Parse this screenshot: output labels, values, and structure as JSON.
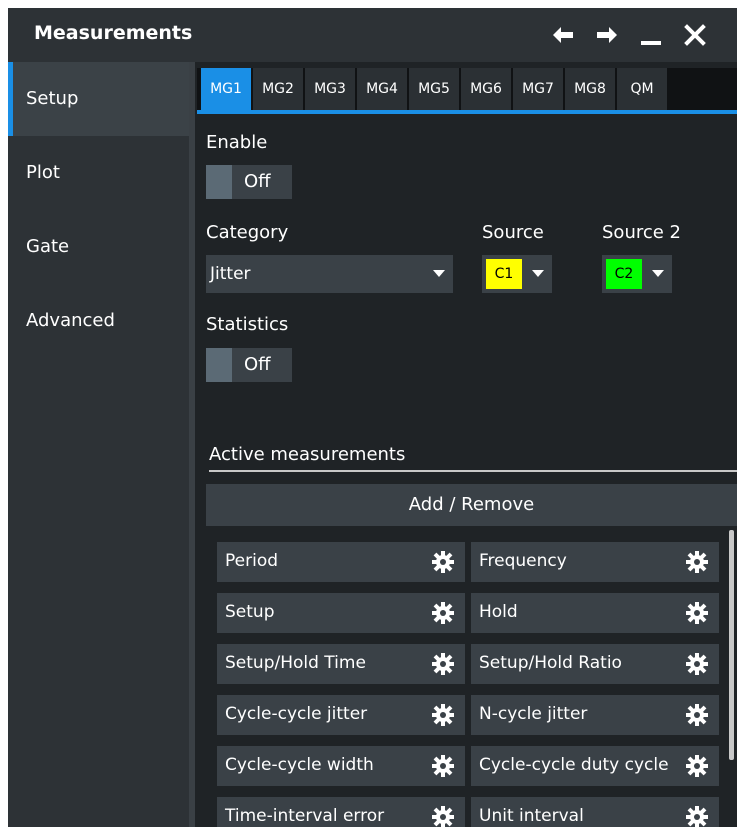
{
  "window": {
    "title": "Measurements"
  },
  "sidebar": {
    "items": [
      {
        "label": "Setup",
        "active": true
      },
      {
        "label": "Plot",
        "active": false
      },
      {
        "label": "Gate",
        "active": false
      },
      {
        "label": "Advanced",
        "active": false
      }
    ]
  },
  "tabs": [
    {
      "label": "MG1",
      "active": true
    },
    {
      "label": "MG2"
    },
    {
      "label": "MG3"
    },
    {
      "label": "MG4"
    },
    {
      "label": "MG5"
    },
    {
      "label": "MG6"
    },
    {
      "label": "MG7"
    },
    {
      "label": "MG8"
    },
    {
      "label": "QM"
    }
  ],
  "setup": {
    "enable_label": "Enable",
    "enable_value": "Off",
    "category_label": "Category",
    "category_value": "Jitter",
    "source_label": "Source",
    "source_value": "C1",
    "source_color": "#ffff00",
    "source2_label": "Source 2",
    "source2_value": "C2",
    "source2_color": "#00ff00",
    "statistics_label": "Statistics",
    "statistics_value": "Off"
  },
  "active_measurements": {
    "title": "Active measurements",
    "add_remove_label": "Add / Remove",
    "items": [
      {
        "label": "Period"
      },
      {
        "label": "Frequency"
      },
      {
        "label": "Setup"
      },
      {
        "label": "Hold"
      },
      {
        "label": "Setup/Hold Time"
      },
      {
        "label": "Setup/Hold Ratio"
      },
      {
        "label": "Cycle-cycle jitter"
      },
      {
        "label": "N-cycle jitter"
      },
      {
        "label": "Cycle-cycle width"
      },
      {
        "label": "Cycle-cycle duty cycle"
      },
      {
        "label": "Time-interval error"
      },
      {
        "label": "Unit interval"
      }
    ]
  },
  "colors": {
    "accent": "#1a8fe6",
    "panel": "#1f2326",
    "control": "#3a4147"
  },
  "icons": {
    "back": "arrow-left-icon",
    "forward": "arrow-right-icon",
    "minimize": "minimize-icon",
    "close": "close-icon",
    "settings": "gear-icon",
    "dropdown": "chevron-down-icon"
  }
}
